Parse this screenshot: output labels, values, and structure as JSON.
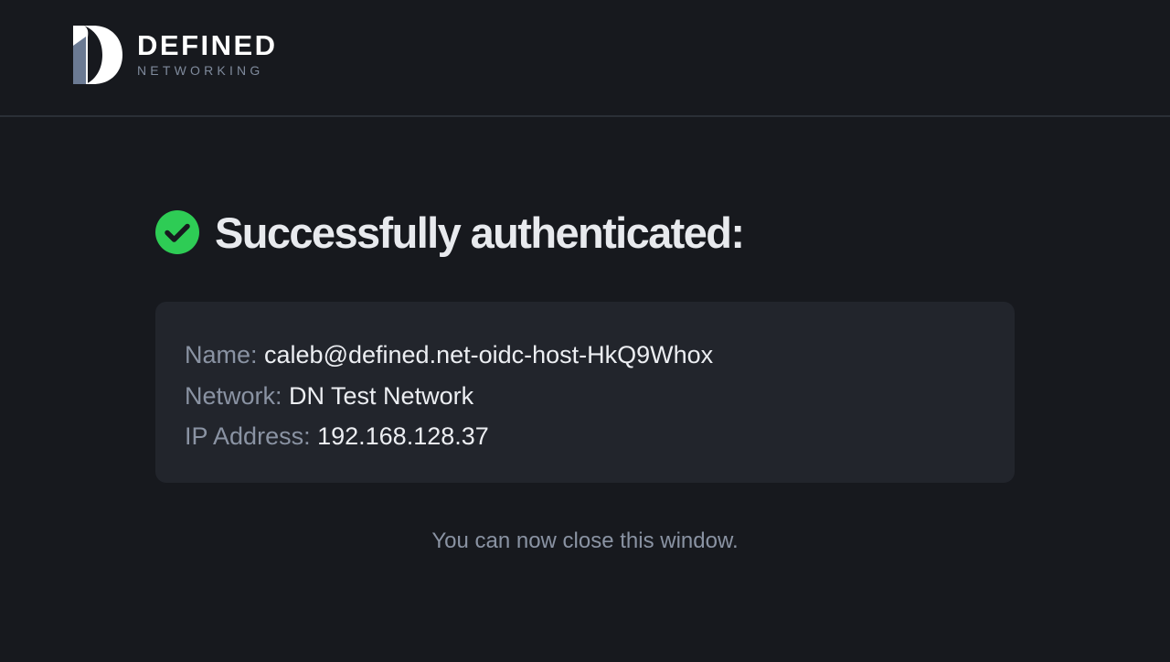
{
  "brand": {
    "name": "DEFINED",
    "tagline": "NETWORKING",
    "accent_color": "#6b7a93"
  },
  "status": {
    "icon": "check-circle-icon",
    "color": "#2ecc55",
    "title": "Successfully authenticated:"
  },
  "details": [
    {
      "label": "Name:",
      "value": "caleb@defined.net-oidc-host-HkQ9Whox"
    },
    {
      "label": "Network:",
      "value": "DN Test Network"
    },
    {
      "label": "IP Address:",
      "value": "192.168.128.37"
    }
  ],
  "footer": {
    "message": "You can now close this window."
  }
}
